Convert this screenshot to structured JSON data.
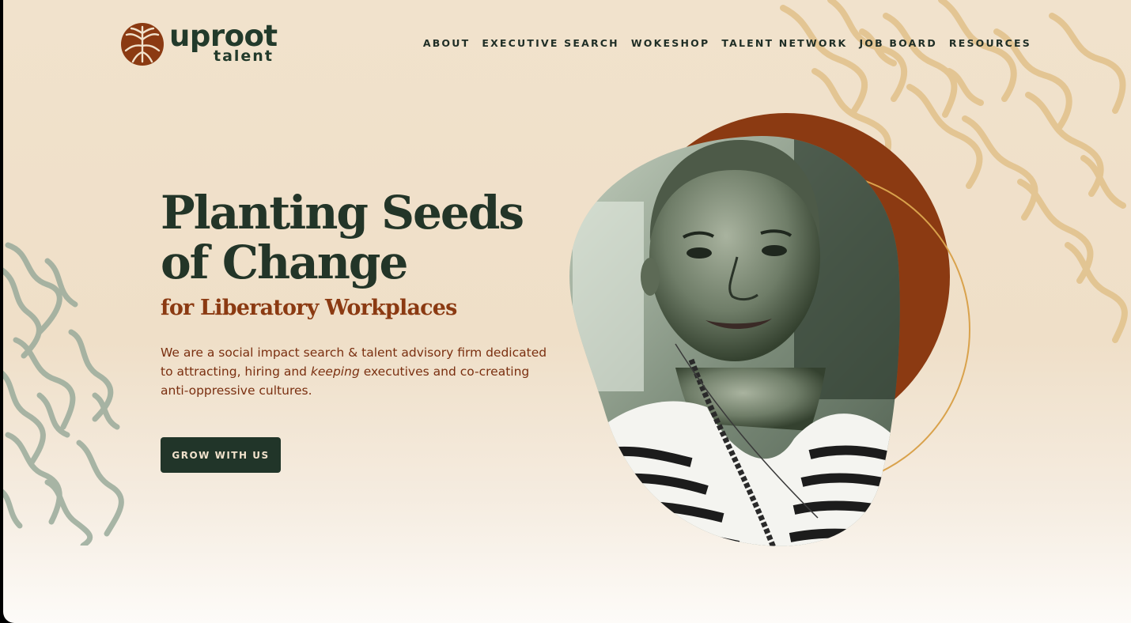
{
  "brand": {
    "name_line1": "uproot",
    "name_line2": "talent",
    "logo_icon": "tree-roots-circle-icon",
    "colors": {
      "dark_green": "#213529",
      "rust": "#8b3a12",
      "cream": "#f1e2cc",
      "gold": "#d9a24c",
      "sage": "#9aab9b"
    }
  },
  "nav": {
    "items": [
      {
        "label": "ABOUT"
      },
      {
        "label": "EXECUTIVE SEARCH"
      },
      {
        "label": "WOKESHOP"
      },
      {
        "label": "TALENT NETWORK"
      },
      {
        "label": "JOB BOARD"
      },
      {
        "label": "RESOURCES"
      }
    ]
  },
  "hero": {
    "title_line1": "Planting Seeds",
    "title_line2": "of Change",
    "subtitle": "for Liberatory Workplaces",
    "desc_before": "We are a social impact search & talent advisory firm dedicated to attracting, hiring and ",
    "desc_emphasis": "keeping",
    "desc_after": " executives and co-creating anti-oppressive cultures.",
    "cta_label": "GROW WITH US",
    "portrait_icon": "person-portrait-icon"
  }
}
